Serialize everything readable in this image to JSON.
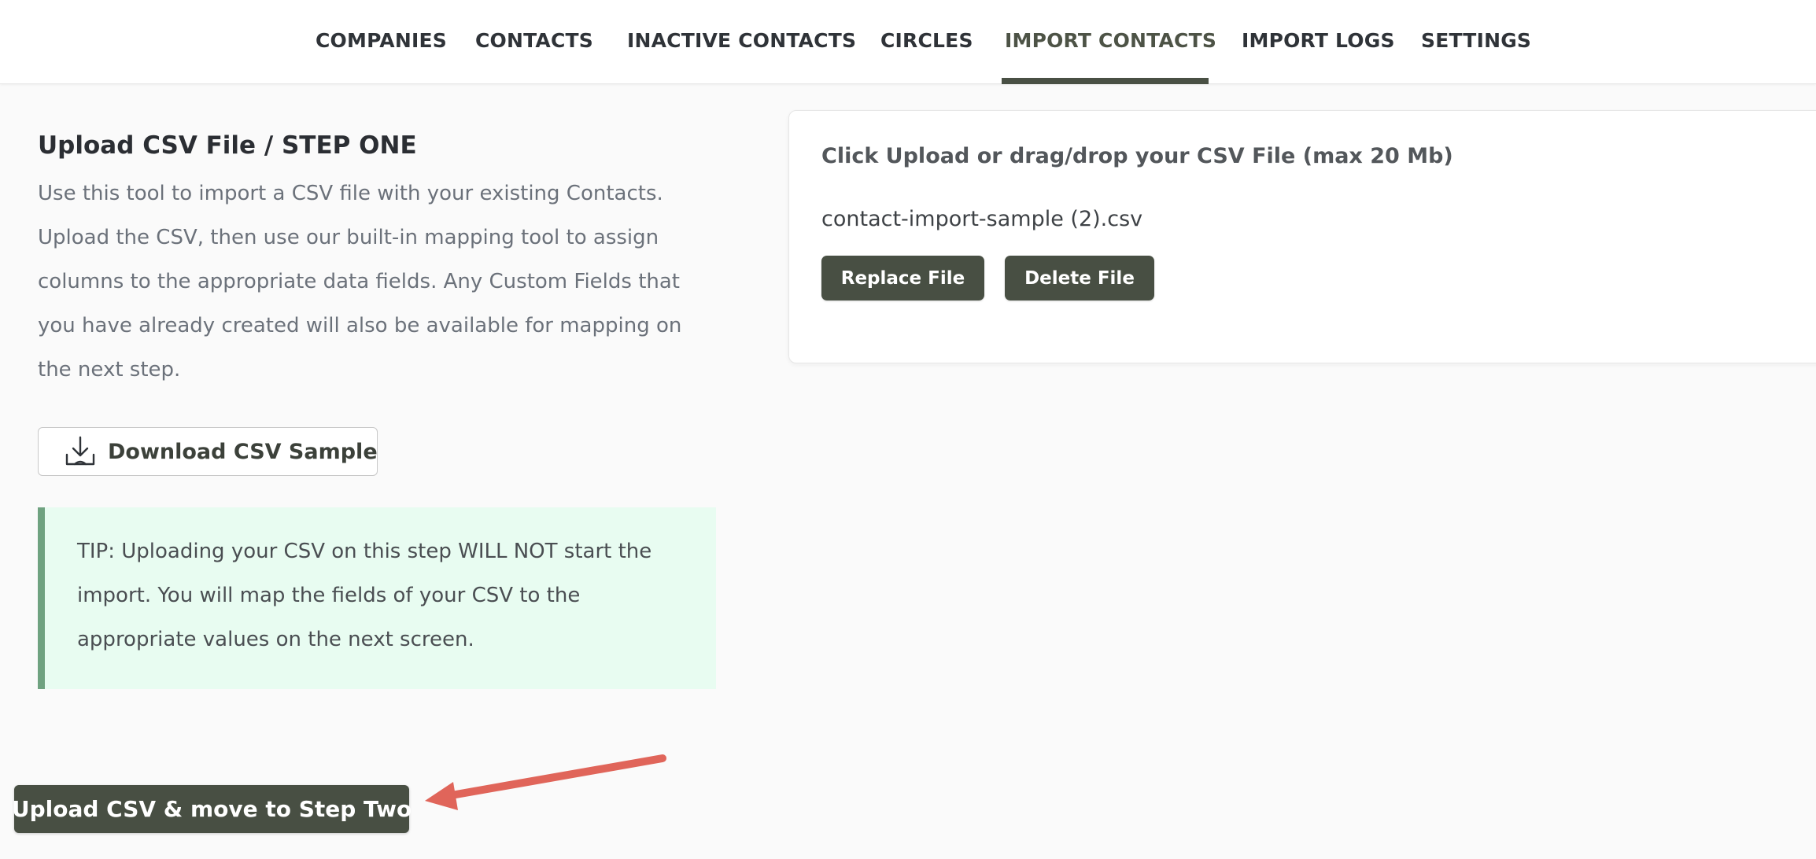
{
  "nav": {
    "tabs": [
      {
        "label": "COMPANIES",
        "active": false
      },
      {
        "label": "CONTACTS",
        "active": false
      },
      {
        "label": "INACTIVE CONTACTS",
        "active": false
      },
      {
        "label": "CIRCLES",
        "active": false
      },
      {
        "label": "IMPORT CONTACTS",
        "active": true
      },
      {
        "label": "IMPORT LOGS",
        "active": false
      },
      {
        "label": "SETTINGS",
        "active": false
      }
    ]
  },
  "step": {
    "title": "Upload CSV File / STEP ONE",
    "description": "Use this tool to import a CSV file with your existing Contacts. Upload the CSV, then use our built-in mapping tool to assign columns to the appropriate data fields. Any Custom Fields that you have already created will also be available for mapping on the next step.",
    "download_label": "Download CSV Sample",
    "download_icon": "download-tray-icon",
    "tip": "TIP: Uploading your CSV on this step WILL NOT start the import. You will map the fields of your CSV to the appropriate values on the next screen."
  },
  "upload": {
    "heading": "Click Upload or drag/drop your CSV File (max 20 Mb)",
    "file_name": "contact-import-sample (2).csv",
    "replace_label": "Replace File",
    "delete_label": "Delete File"
  },
  "primary_action": {
    "label": "Upload CSV & move to Step Two"
  },
  "colors": {
    "accent": "#484f43",
    "tip_background": "#e8fcf1",
    "tip_border": "#6fa280",
    "annotation_arrow": "#e0655a"
  }
}
